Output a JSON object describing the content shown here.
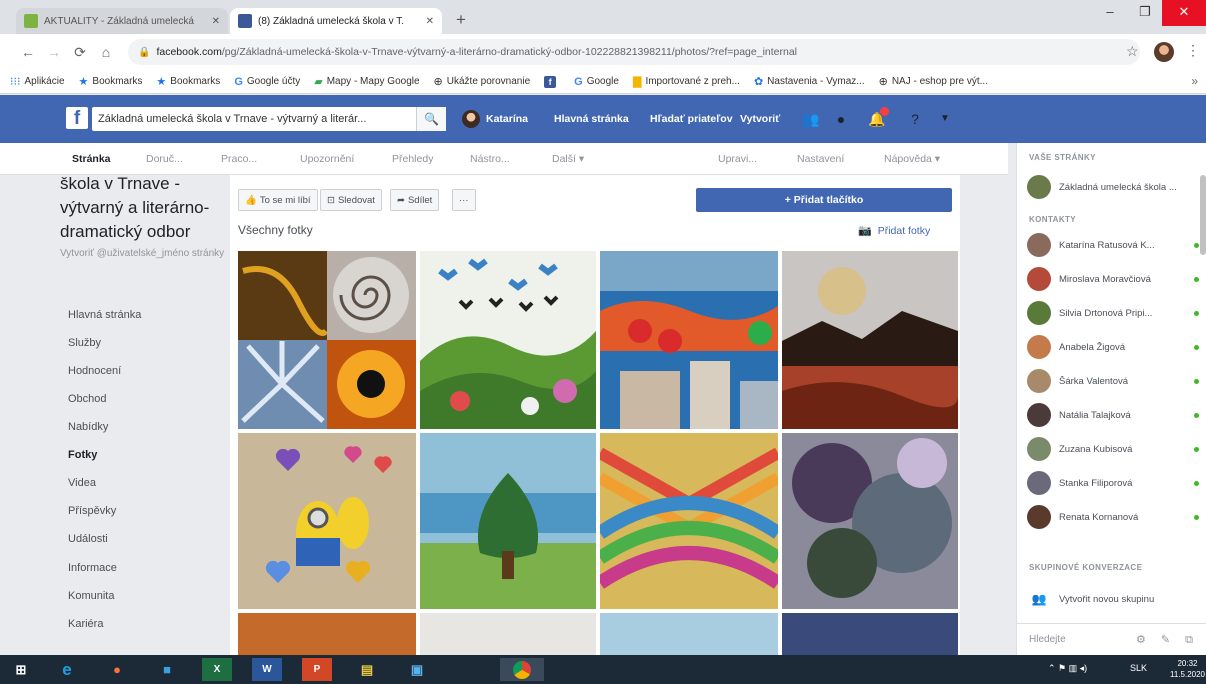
{
  "browser": {
    "tabs": [
      {
        "label": "AKTUALITY - Základná umelecká",
        "active": false
      },
      {
        "label": "(8) Základná umelecká škola v T.",
        "active": true
      }
    ],
    "new_tab": "+",
    "window": {
      "minimize": "–",
      "maximize": "❐",
      "close": "✕"
    },
    "nav": {
      "back": "←",
      "forward": "→",
      "reload": "⟳",
      "home": "⌂"
    },
    "address": {
      "host": "facebook.com",
      "path": "/pg/Základná-umelecká-škola-v-Trnave-výtvarný-a-literárno-dramatický-odbor-102228821398211/photos/?ref=page_internal"
    },
    "bookmarks": [
      {
        "label": "Aplikácie",
        "icon": "apps-icon"
      },
      {
        "label": "Bookmarks",
        "icon": "star-icon"
      },
      {
        "label": "Bookmarks",
        "icon": "star-icon"
      },
      {
        "label": "Google účty",
        "icon": "google-icon"
      },
      {
        "label": "Mapy - Mapy Google",
        "icon": "maps-icon"
      },
      {
        "label": "Ukážte porovnanie",
        "icon": "globe-icon"
      },
      {
        "label": "",
        "icon": "facebook-icon"
      },
      {
        "label": "Google",
        "icon": "google-icon"
      },
      {
        "label": "Importované z preh...",
        "icon": "folder-icon"
      },
      {
        "label": "Nastavenia - Vymaz...",
        "icon": "gear-icon"
      },
      {
        "label": "NAJ - eshop pre výt...",
        "icon": "globe-icon"
      }
    ],
    "bookmarks_more": "»"
  },
  "fb": {
    "logo": "f",
    "search_value": "Základná umelecká škola v Trnave - výtvarný a literár...",
    "search_icon": "🔍",
    "user": "Katarína",
    "nav": [
      "Hlavná stránka",
      "Hľadať priateľov",
      "Vytvoriť"
    ],
    "icons": [
      "friends-icon",
      "messenger-icon",
      "notifications-icon",
      "help-icon",
      "dropdown-icon"
    ]
  },
  "page_tabs": {
    "items": [
      "Stránka",
      "Doruč...",
      "Praco...",
      "Upozornění",
      "Přehledy",
      "Nástro...",
      "Další ▾"
    ],
    "right": [
      "Upravi...",
      "Nastavení",
      "Nápověda ▾"
    ]
  },
  "sidebar": {
    "title": "škola v Trnave - výtvarný a literárno-dramatický odbor",
    "username": "Vytvoriť @uživatelské_jméno stránky",
    "items": [
      "Hlavná stránka",
      "Služby",
      "Hodnocení",
      "Obchod",
      "Nabídky",
      "Fotky",
      "Videa",
      "Příspěvky",
      "Události",
      "Informace",
      "Komunita",
      "Kariéra"
    ],
    "active": "Fotky"
  },
  "actions": {
    "like": "To se mi líbí",
    "follow": "Sledovat",
    "share": "Sdílet",
    "more": "···",
    "add_button": "+ Přidat tlačítko"
  },
  "photos": {
    "section_title": "Všechny fotky",
    "add_photos": "Přidat fotky"
  },
  "chat": {
    "your_pages_header": "VAŠE STRÁNKY",
    "page_item": "Základná umelecká škola ...",
    "contacts_header": "KONTAKTY",
    "contacts": [
      "Katarína Ratusová K...",
      "Miroslava Moravčiová",
      "Silvia Drtonová Pripi...",
      "Anabela Žigová",
      "Šárka Valentová",
      "Natália Talajková",
      "Zuzana Kubisová",
      "Stanka Filiporová",
      "Renata Kornanová"
    ],
    "groups_header": "SKUPINOVÉ KONVERZACE",
    "new_group": "Vytvořit novou skupinu",
    "search_placeholder": "Hledejte",
    "search_tools": "⚙ ✎ ⧉"
  },
  "taskbar": {
    "apps": [
      "windows-start",
      "internet-explorer",
      "firefox",
      "file-explorer",
      "excel",
      "word",
      "powerpoint",
      "photo-viewer",
      "remote-desktop",
      "chrome"
    ],
    "tray_lang": "SLK",
    "clock_time": "20:32",
    "clock_date": "11.5.2020"
  }
}
